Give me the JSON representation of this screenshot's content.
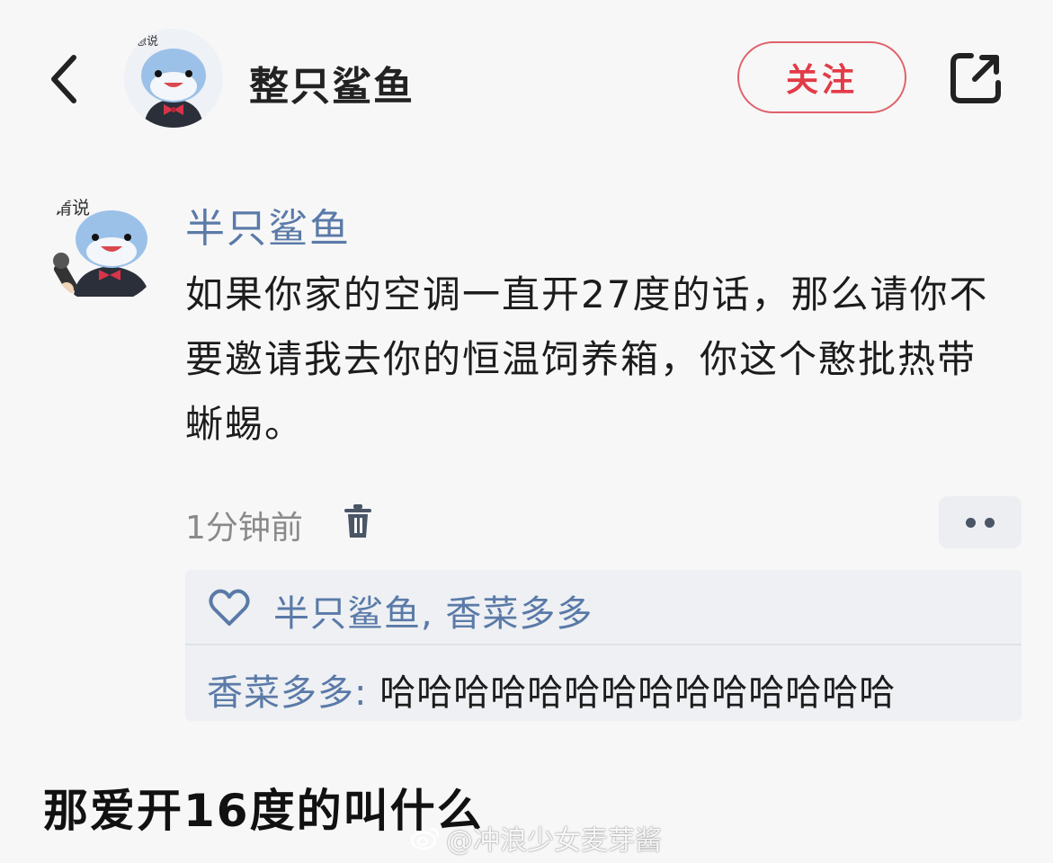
{
  "header": {
    "author_name": "整只鲨鱼",
    "follow_label": "关注",
    "avatar_bubble": "想说"
  },
  "comment": {
    "avatar_bubble": "请说",
    "author": "半只鲨鱼",
    "text": "如果你家的空调一直开27度的话，那么请你不要邀请我去你的恒温饲养箱，你这个憨批热带蜥蜴。",
    "time": "1分钟前"
  },
  "replies": {
    "likers": "半只鲨鱼, 香菜多多",
    "reply_author": "香菜多多:",
    "reply_text": " 哈哈哈哈哈哈哈哈哈哈哈哈哈哈"
  },
  "caption": "那爱开16度的叫什么",
  "watermark": "@冲浪少女麦芽酱",
  "colors": {
    "accent_red": "#e23b47",
    "link_blue": "#5a7aa8",
    "background": "#f7f7f7"
  }
}
